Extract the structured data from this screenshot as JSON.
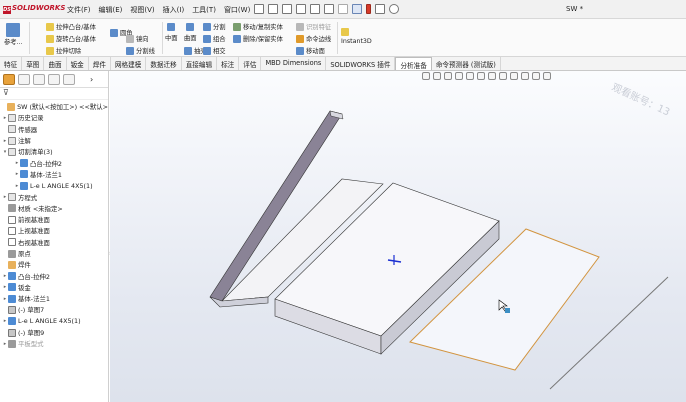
{
  "app": {
    "logo_text": "SOLIDWORKS",
    "logo_mark": "DS",
    "doc_title": "SW *"
  },
  "menu": [
    "文件(F)",
    "编辑(E)",
    "视图(V)",
    "插入(I)",
    "工具(T)",
    "窗口(W)"
  ],
  "ribbon": {
    "ref": "参考...",
    "p1": "拉伸凸台/基体",
    "p2": "旋转凸台/基体",
    "p3": "拉伸切除",
    "p4": "圆角",
    "p5": "镜向",
    "p6": "分割线",
    "p7": "中面",
    "p8": "曲面",
    "p9": "抽壳",
    "p10": "分割",
    "p11": "组合",
    "p12": "相交",
    "p13": "移动/复制实体",
    "p14": "删除/保留实体",
    "p15": "移动面",
    "p16": "识别特征",
    "p17": "命令边线",
    "instant": "Instant3D"
  },
  "tabs": [
    "特征",
    "草图",
    "曲面",
    "钣金",
    "焊件",
    "网格建模",
    "数据迁移",
    "直接编辑",
    "标注",
    "评估",
    "MBD Dimensions",
    "SOLIDWORKS 插件",
    "分析准备",
    "命令预测器 (测试版)"
  ],
  "active_tab": "分析准备",
  "tree": [
    {
      "label": "SW (默认<按加工>) <<默认>",
      "icon": "part",
      "exp": ""
    },
    {
      "label": "历史记录",
      "icon": "fo",
      "exp": "▸"
    },
    {
      "label": "传感器",
      "icon": "fo",
      "exp": ""
    },
    {
      "label": "注解",
      "icon": "fo",
      "exp": "▸"
    },
    {
      "label": "切割清单(3)",
      "icon": "fo",
      "exp": "▾"
    },
    {
      "label": "凸台-拉伸2",
      "icon": "bl",
      "exp": "▸",
      "indent": 1
    },
    {
      "label": "基体-法兰1",
      "icon": "bl",
      "exp": "▸",
      "indent": 1
    },
    {
      "label": "L-e L ANGLE 4X5(1)",
      "icon": "bl",
      "exp": "▸",
      "indent": 1
    },
    {
      "label": "方程式",
      "icon": "fo",
      "exp": "▸"
    },
    {
      "label": "材质 <未指定>",
      "icon": "gr",
      "exp": ""
    },
    {
      "label": "前视基准面",
      "icon": "pl",
      "exp": ""
    },
    {
      "label": "上视基准面",
      "icon": "pl",
      "exp": ""
    },
    {
      "label": "右视基准面",
      "icon": "pl",
      "exp": ""
    },
    {
      "label": "原点",
      "icon": "gr",
      "exp": ""
    },
    {
      "label": "焊件",
      "icon": "or",
      "exp": ""
    },
    {
      "label": "凸台-拉伸2",
      "icon": "bl",
      "exp": "▸"
    },
    {
      "label": "钣金",
      "icon": "bl",
      "exp": "▸"
    },
    {
      "label": "基体-法兰1",
      "icon": "bl",
      "exp": "▸"
    },
    {
      "label": "(-) 草图7",
      "icon": "re",
      "exp": ""
    },
    {
      "label": "L-e L ANGLE 4X5(1)",
      "icon": "bl",
      "exp": "▸"
    },
    {
      "label": "(-) 草图9",
      "icon": "re",
      "exp": ""
    },
    {
      "label": "平板型式",
      "icon": "gr",
      "exp": "▸",
      "dim": true
    }
  ],
  "watermark": "观看账号：13"
}
